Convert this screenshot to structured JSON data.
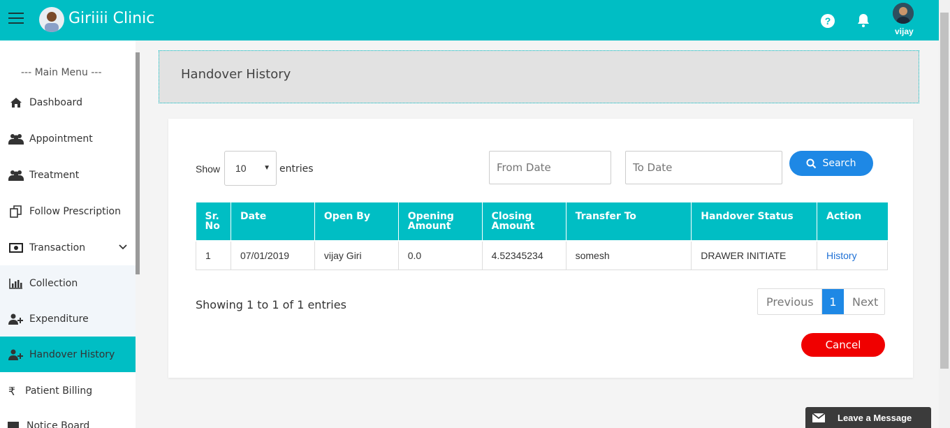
{
  "header": {
    "app_title": "Giriiii Clinic",
    "user_name": "vijay",
    "help_glyph": "?"
  },
  "sidebar": {
    "heading": "--- Main Menu ---",
    "items": [
      {
        "label": "Dashboard",
        "icon": "home-icon"
      },
      {
        "label": "Appointment",
        "icon": "users-icon"
      },
      {
        "label": "Treatment",
        "icon": "users-icon"
      },
      {
        "label": "Follow Prescription",
        "icon": "copy-icon"
      },
      {
        "label": "Transaction",
        "icon": "money-icon"
      },
      {
        "label": "Collection",
        "icon": "bar-chart-icon"
      },
      {
        "label": "Expenditure",
        "icon": "user-plus-icon"
      },
      {
        "label": "Handover History",
        "icon": "user-plus-icon"
      },
      {
        "label": "Patient Billing",
        "icon": "rupee-icon"
      },
      {
        "label": "Notice Board",
        "icon": "notice-icon"
      }
    ]
  },
  "page": {
    "title": "Handover History"
  },
  "filters": {
    "show_label": "Show",
    "entries_value": "10",
    "entries_label": "entries",
    "from_date_placeholder": "From Date",
    "to_date_placeholder": "To Date",
    "search_label": "Search"
  },
  "table": {
    "columns": [
      [
        "Sr.",
        "No"
      ],
      [
        "Date",
        ""
      ],
      [
        "Open By",
        ""
      ],
      [
        "Opening",
        "Amount"
      ],
      [
        "Closing",
        "Amount"
      ],
      [
        "Transfer To",
        ""
      ],
      [
        "Handover Status",
        ""
      ],
      [
        "Action",
        ""
      ]
    ],
    "rows": [
      {
        "sr": "1",
        "date": "07/01/2019",
        "open_by": "vijay Giri",
        "opening": "0.0",
        "closing": "4.52345234",
        "transfer_to": "somesh",
        "status": "DRAWER INITIATE",
        "action": "History"
      }
    ]
  },
  "info": "Showing 1 to 1 of 1 entries",
  "pagination": {
    "previous": "Previous",
    "current": "1",
    "next": "Next"
  },
  "cancel_label": "Cancel",
  "chat_widget": {
    "label": "Leave a Message"
  },
  "colors": {
    "primary": "#00bec4",
    "accent_blue": "#1e88e5",
    "danger": "#f00000"
  }
}
